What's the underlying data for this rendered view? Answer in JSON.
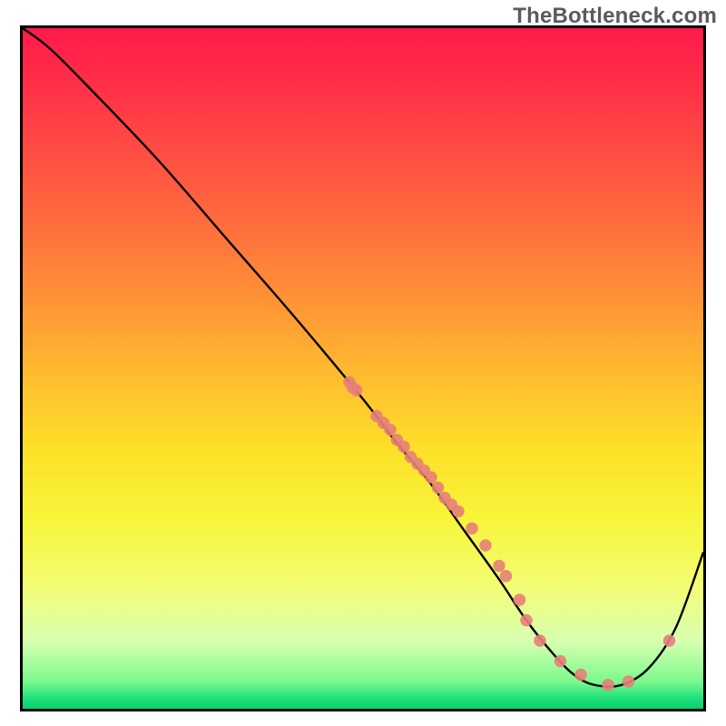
{
  "watermark": "TheBottleneck.com",
  "chart_data": {
    "type": "line",
    "title": "",
    "xlabel": "",
    "ylabel": "",
    "xlim": [
      0,
      100
    ],
    "ylim": [
      0,
      100
    ],
    "grid": false,
    "legend": false,
    "series": [
      {
        "name": "curve",
        "type": "line",
        "color": "#000000",
        "x": [
          0,
          4,
          10,
          20,
          30,
          40,
          50,
          55,
          60,
          65,
          70,
          74,
          78,
          81,
          84,
          88,
          92,
          96,
          100
        ],
        "y": [
          100,
          97,
          91,
          80.5,
          69,
          57.5,
          45.5,
          39,
          33,
          26,
          19,
          13,
          8,
          5,
          3.5,
          3.5,
          6,
          12,
          23
        ]
      },
      {
        "name": "markers",
        "type": "scatter",
        "color": "#e77f7a",
        "x": [
          48,
          48.5,
          49,
          52,
          53,
          54,
          55,
          56,
          57,
          58,
          59,
          60,
          61,
          62,
          63,
          64,
          66,
          68,
          70,
          71,
          73,
          74,
          76,
          79,
          82,
          86,
          89,
          95
        ],
        "y": [
          48,
          47.2,
          46.8,
          43,
          42,
          41,
          39.5,
          38.5,
          37,
          36,
          35,
          34,
          32.5,
          31,
          30,
          29,
          26.5,
          24,
          21,
          19.5,
          16,
          13,
          10,
          7,
          5,
          3.5,
          4,
          10
        ]
      }
    ],
    "background_gradient_stops": [
      {
        "offset": 0.0,
        "color": "#ff1a4a"
      },
      {
        "offset": 0.12,
        "color": "#ff3a46"
      },
      {
        "offset": 0.28,
        "color": "#ff6a3e"
      },
      {
        "offset": 0.4,
        "color": "#ff9336"
      },
      {
        "offset": 0.52,
        "color": "#ffbf2f"
      },
      {
        "offset": 0.62,
        "color": "#fde128"
      },
      {
        "offset": 0.72,
        "color": "#f7f53a"
      },
      {
        "offset": 0.82,
        "color": "#f3fd74"
      },
      {
        "offset": 0.9,
        "color": "#d9ffb0"
      },
      {
        "offset": 0.96,
        "color": "#7cf98e"
      },
      {
        "offset": 0.985,
        "color": "#1de07a"
      },
      {
        "offset": 1.0,
        "color": "#0bce6e"
      }
    ]
  }
}
